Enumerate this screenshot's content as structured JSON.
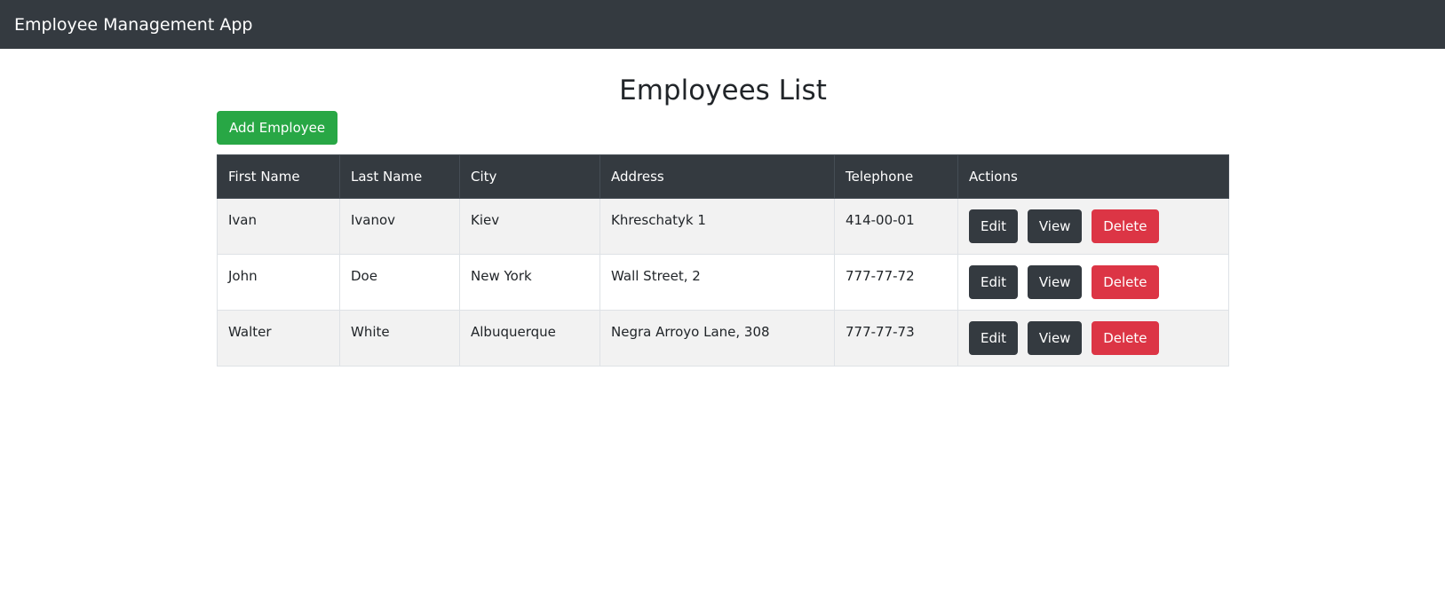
{
  "navbar": {
    "brand": "Employee Management App"
  },
  "page": {
    "title": "Employees List",
    "add_button_label": "Add Employee"
  },
  "table": {
    "headers": [
      "First Name",
      "Last Name",
      "City",
      "Address",
      "Telephone",
      "Actions"
    ],
    "rows": [
      {
        "first_name": "Ivan",
        "last_name": "Ivanov",
        "city": "Kiev",
        "address": "Khreschatyk 1",
        "telephone": "414-00-01"
      },
      {
        "first_name": "John",
        "last_name": "Doe",
        "city": "New York",
        "address": "Wall Street, 2",
        "telephone": "777-77-72"
      },
      {
        "first_name": "Walter",
        "last_name": "White",
        "city": "Albuquerque",
        "address": "Negra Arroyo Lane, 308",
        "telephone": "777-77-73"
      }
    ],
    "actions": {
      "edit": "Edit",
      "view": "View",
      "delete": "Delete"
    }
  },
  "colors": {
    "navbar": "#343a40",
    "success": "#28a745",
    "dark": "#343a40",
    "danger": "#dc3545",
    "striped_row": "#f2f2f2"
  }
}
